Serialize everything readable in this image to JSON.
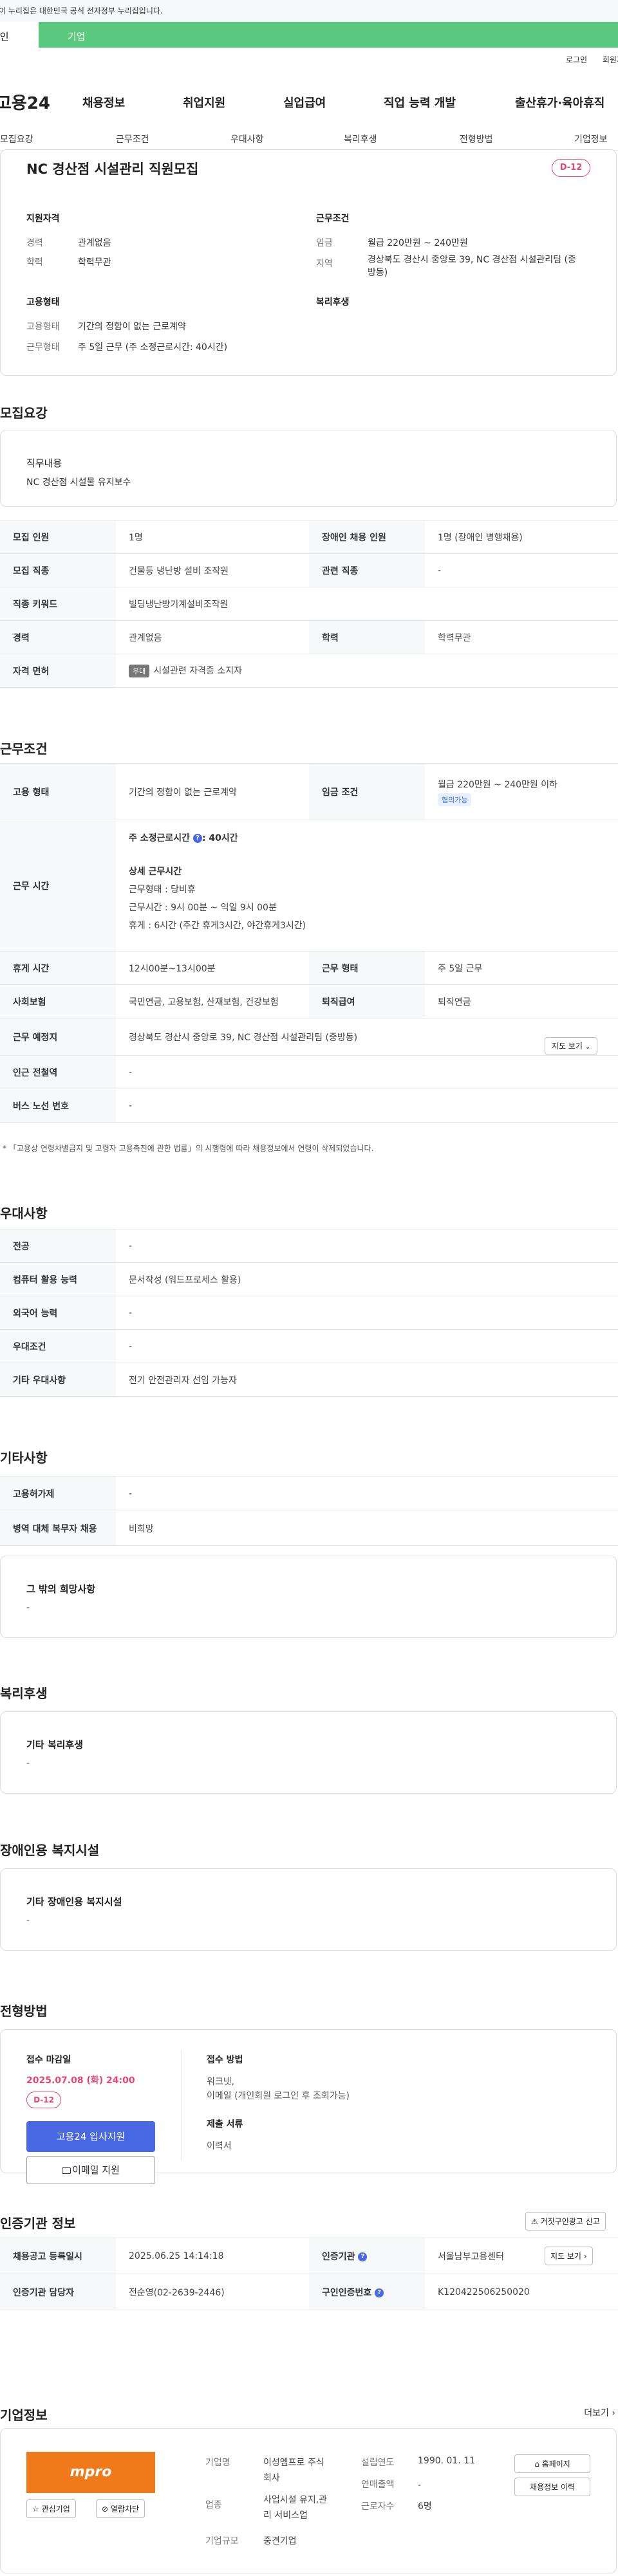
{
  "top_notice": "이 누리집은 대한민국 공식 전자정부 누리집입니다.",
  "top_tabs": {
    "individual": "개인",
    "enterprise": "기업"
  },
  "util": {
    "login": "로그인",
    "signup": "회원가입"
  },
  "gnb": {
    "logo": "고용24",
    "menu": [
      "채용정보",
      "취업지원",
      "실업급여",
      "직업 능력 개발",
      "출산휴가·육아휴직"
    ]
  },
  "subnav": [
    "모집요강",
    "근무조건",
    "우대사항",
    "복리후생",
    "전형방법",
    "기업정보"
  ],
  "job": {
    "title": "NC 경산점 시설관리 직원모집",
    "dday": "D-12"
  },
  "summary": {
    "qual_head": "지원자격",
    "career_label": "경력",
    "career_value": "관계없음",
    "edu_label": "학력",
    "edu_value": "학력무관",
    "cond_head": "근무조건",
    "wage_label": "임금",
    "wage_value": "월급 220만원 ~ 240만원",
    "area_label": "지역",
    "area_value_1": "경상북도 경산시 중앙로 39, NC 경산점 시설관리팀 (중",
    "area_value_2": "방동)",
    "emp_head": "고용형태",
    "emp_type_label": "고용형태",
    "emp_type_value": "기간의 정함이 없는 근로계약",
    "work_type_label": "근무형태",
    "work_type_value": "주 5일 근무 (주 소정근로시간: 40시간)",
    "welfare_head": "복리후생"
  },
  "recruit": {
    "title": "모집요강",
    "duty_label": "직무내용",
    "duty_value": "NC 경산점 시설물 유지보수",
    "rows": [
      {
        "l1": "모집 인원",
        "v1": "1명",
        "l2": "장애인 채용 인원",
        "v2": "1명 (장애인 병행채용)"
      },
      {
        "l1": "모집 직종",
        "v1": "건물등 냉난방 설비 조작원",
        "l2": "관련 직종",
        "v2": "-"
      },
      {
        "l1": "직종 키워드",
        "v1": "빌딩냉난방기계설비조작원"
      },
      {
        "l1": "경력",
        "v1": "관계없음",
        "l2": "학력",
        "v2": "학력무관"
      },
      {
        "l1": "자격 면허",
        "badge": "우대",
        "v1": "시설관련 자격증 소지자"
      }
    ]
  },
  "conditions": {
    "title": "근무조건",
    "employment_label": "고용 형태",
    "employment_value": "기간의 정함이 없는 근로계약",
    "wage_label": "임금 조건",
    "wage_value": "월급 220만원 ~ 240만원 이하",
    "wage_badge": "협의가능",
    "hours_label": "근무 시간",
    "hours_weekly": "주 소정근로시간",
    "hours_weekly_value": ": 40시간",
    "hours_detail_head": "상세 근무시간",
    "hours_detail": [
      "근무형태 : 당비휴",
      "근무시간 : 9시 00분 ~ 익일 9시 00분",
      "휴게 : 6시간 (주간 휴게3시간, 야간휴게3시간)"
    ],
    "rest_label": "휴게 시간",
    "rest_value": "12시00분~13시00분",
    "worktype_label": "근무 형태",
    "worktype_value": "주 5일 근무",
    "insurance_label": "사회보험",
    "insurance_value": "국민연금, 고용보험, 산재보험, 건강보험",
    "retire_label": "퇴직급여",
    "retire_value": "퇴직연금",
    "place_label": "근무 예정지",
    "place_value": "경상북도 경산시 중앙로 39, NC 경산점 시설관리팀 (중방동)",
    "map_button": "지도 보기",
    "station_label": "인근 전철역",
    "station_value": "-",
    "bus_label": "버스 노선 번호",
    "bus_value": "-",
    "note": "* 「고용상 연령차별금지 및 고령자 고용촉진에 관한 법률」의 시행령에 따라 채용정보에서 연령이 삭제되었습니다."
  },
  "preference": {
    "title": "우대사항",
    "rows": [
      {
        "label": "전공",
        "value": "-"
      },
      {
        "label": "컴퓨터 활용 능력",
        "value": "문서작성 (워드프로세스 활용)"
      },
      {
        "label": "외국어 능력",
        "value": "-"
      },
      {
        "label": "우대조건",
        "value": "-"
      },
      {
        "label": "기타 우대사항",
        "value": "전기 안전관리자 선임 가능자"
      }
    ]
  },
  "etc": {
    "title": "기타사항",
    "rows": [
      {
        "label": "고용허가제",
        "value": "-"
      },
      {
        "label": "병역 대체 복무자 채용",
        "value": "비희망"
      }
    ],
    "other_label": "그 밖의 희망사항",
    "other_value": "-"
  },
  "welfare": {
    "title": "복리후생",
    "label": "기타 복리후생",
    "value": "-"
  },
  "disability": {
    "title": "장애인용 복지시설",
    "label": "기타 장애인용 복지시설",
    "value": "-"
  },
  "screening": {
    "title": "전형방법",
    "deadline_label": "접수 마감일",
    "deadline_value": "2025.07.08 (화) 24:00",
    "dday": "D-12",
    "apply_button": "고용24 입사지원",
    "email_button": "이메일 지원",
    "method_label": "접수 방법",
    "method_value_1": "워크넷,",
    "method_value_2": "이메일 (개인회원 로그인 후 조회가능)",
    "docs_label": "제출 서류",
    "docs_value": "이력서"
  },
  "agency": {
    "title": "인증기관 정보",
    "report_button": "거짓구인광고 신고",
    "reg_label": "채용공고 등록일시",
    "reg_value": "2025.06.25 14:14:18",
    "org_label": "인증기관",
    "org_value": "서울남부고용센터",
    "map_button": "지도 보기",
    "mgr_label": "인증기관 담당자",
    "mgr_value": "전순영(02-2639-2446)",
    "no_label": "구인인증번호",
    "no_value": "K120422506250020"
  },
  "company": {
    "title": "기업정보",
    "more": "더보기",
    "logo_text": "mpro",
    "fav_button": "관심기업",
    "block_button": "열람차단",
    "name_label": "기업명",
    "name_value_1": "이성엠프로 주식",
    "name_value_2": "회사",
    "industry_label": "업종",
    "industry_value_1": "사업시설 유지,관",
    "industry_value_2": "리 서비스업",
    "size_label": "기업규모",
    "size_value": "중견기업",
    "founded_label": "설립연도",
    "founded_value": "1990. 01. 11",
    "sales_label": "연매출액",
    "sales_value": "-",
    "emp_label": "근로자수",
    "emp_value": "6명",
    "home_button": "홈페이지",
    "jobs_button": "채용정보 이력"
  }
}
